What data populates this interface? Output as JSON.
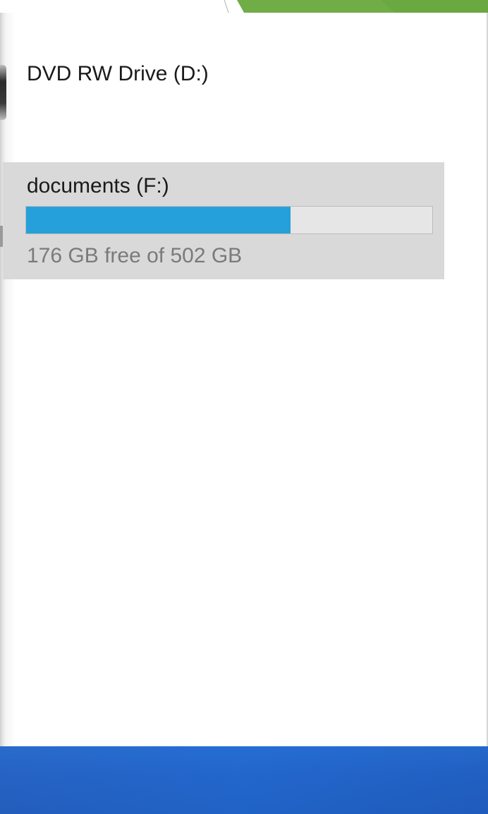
{
  "drives": [
    {
      "label": "DVD RW Drive (D:)",
      "selected": false
    },
    {
      "label": "documents (F:)",
      "free_text": "176 GB free of 502 GB",
      "used_fraction": 0.651,
      "selected": true
    }
  ],
  "colors": {
    "usage_bar": "#26a0da",
    "selection_bg": "#d9d9d9",
    "taskbar": "#1a5ac0",
    "slide_accent": "#70ad47"
  },
  "icons": {
    "dvd_drive": "dvd-drive-icon",
    "documents_drive": "hard-drive-icon"
  }
}
